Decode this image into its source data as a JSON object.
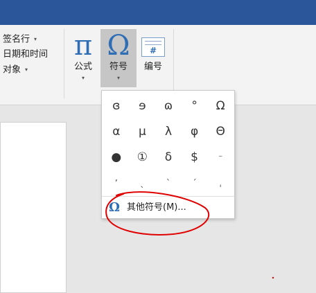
{
  "ribbon": {
    "left_items": [
      {
        "label": "签名行",
        "has_dropdown": true
      },
      {
        "label": "日期和时间",
        "has_dropdown": false
      },
      {
        "label": "对象",
        "has_dropdown": true
      }
    ],
    "equation": {
      "glyph": "π",
      "label": "公式"
    },
    "symbol": {
      "glyph": "Ω",
      "label": "符号"
    },
    "number": {
      "glyph": "#",
      "label": "编号"
    },
    "dropdown_arrow": "▾"
  },
  "symbol_menu": {
    "symbols": [
      "ɞ",
      "ɘ",
      "ɷ",
      "°",
      "Ω",
      "α",
      "μ",
      "λ",
      "φ",
      "Θ",
      "●",
      "①",
      "δ",
      "$",
      "⁻",
      "ʼ",
      "ˎ",
      "ˋ",
      "ˊ",
      "ˌ"
    ],
    "more_symbols": {
      "icon": "Ω",
      "label": "其他符号(M)..."
    }
  },
  "colors": {
    "title_bar": "#2b579a",
    "accent_icon": "#2f6eb5",
    "annotation": "#e00000"
  }
}
